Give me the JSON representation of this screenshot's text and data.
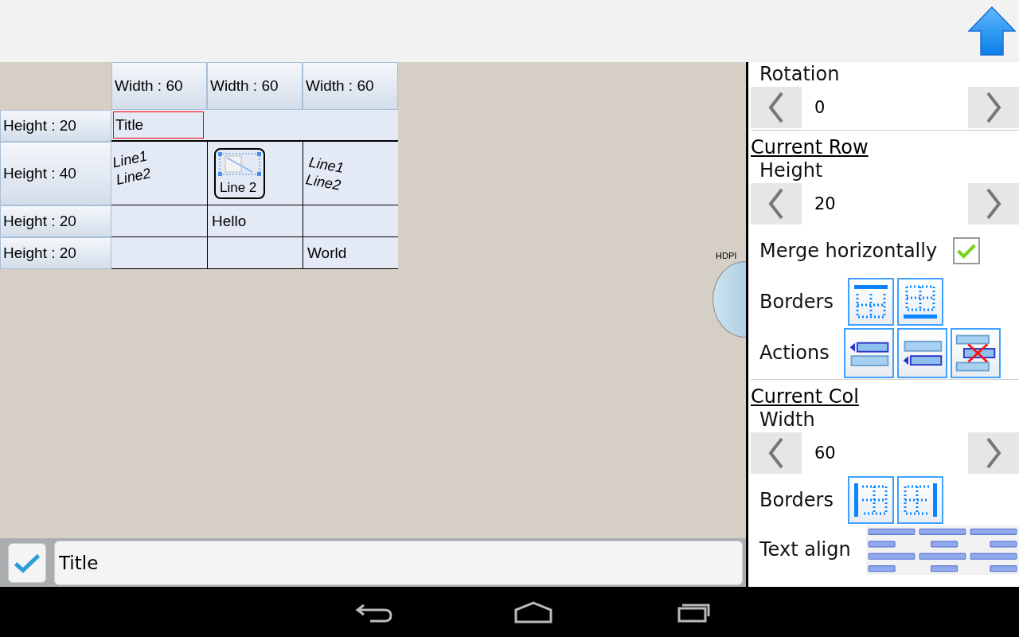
{
  "table": {
    "columns": [
      {
        "label": "Width : 60"
      },
      {
        "label": "Width : 60"
      },
      {
        "label": "Width : 60"
      }
    ],
    "rows": [
      {
        "label": "Height : 20",
        "cells": [
          {
            "kind": "text",
            "text": "Title",
            "selected": true
          }
        ]
      },
      {
        "label": "Height : 40",
        "cells": [
          {
            "kind": "tilted-up",
            "text": "Line1\nLine2",
            "selected": false
          },
          {
            "kind": "picture",
            "text": "Line 2",
            "selected": false
          },
          {
            "kind": "tilted-down",
            "text": "Line1\nLine2",
            "selected": false
          }
        ]
      },
      {
        "label": "Height : 20",
        "cells": [
          {
            "kind": "empty",
            "selected": false
          },
          {
            "kind": "text",
            "text": "Hello",
            "selected": false
          },
          {
            "kind": "empty",
            "selected": false
          }
        ]
      },
      {
        "label": "Height : 20",
        "cells": [
          {
            "kind": "empty",
            "selected": false
          },
          {
            "kind": "empty",
            "selected": false
          },
          {
            "kind": "text",
            "text": "World",
            "selected": false
          }
        ]
      }
    ]
  },
  "side_handle": {
    "label": "HDPI"
  },
  "editor": {
    "value": "Title"
  },
  "panel": {
    "rotation": {
      "label": "Rotation",
      "value": "0"
    },
    "current_row": {
      "title": "Current Row",
      "height": {
        "label": "Height",
        "value": "20"
      },
      "merge": {
        "label": "Merge horizontally",
        "checked": true
      },
      "borders_label": "Borders",
      "actions_label": "Actions"
    },
    "current_col": {
      "title": "Current Col",
      "width": {
        "label": "Width",
        "value": "60"
      },
      "borders_label": "Borders",
      "text_align_label": "Text align"
    }
  }
}
